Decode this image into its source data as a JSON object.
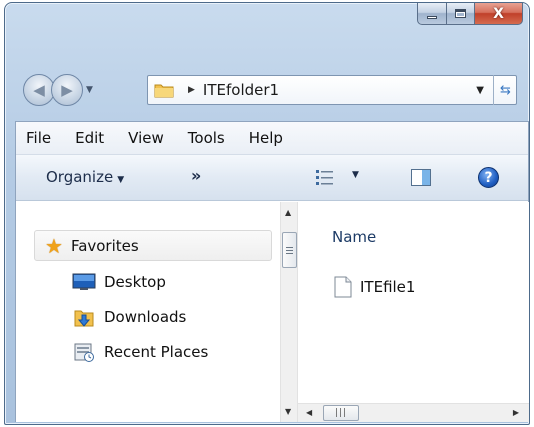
{
  "window": {
    "caption_buttons": {
      "minimize_icon": "minimize-icon",
      "maximize_icon": "maximize-icon",
      "close_icon": "close-icon",
      "close_glyph": "X"
    }
  },
  "navigation": {
    "back_icon": "back-arrow-icon",
    "forward_icon": "forward-arrow-icon",
    "history_icon": "chevron-down-icon"
  },
  "address_bar": {
    "folder_icon": "folder-icon",
    "path": "ITEfolder1",
    "refresh_icon": "refresh-icon"
  },
  "menu": {
    "items": [
      "File",
      "Edit",
      "View",
      "Tools",
      "Help"
    ]
  },
  "toolbar": {
    "organize_label": "Organize",
    "more_label": "»",
    "views_icon": "views-icon",
    "preview_pane_icon": "preview-pane-icon",
    "help_icon": "help-icon",
    "help_glyph": "?"
  },
  "nav_pane": {
    "favorites_label": "Favorites",
    "items": [
      {
        "label": "Desktop",
        "icon": "desktop-icon"
      },
      {
        "label": "Downloads",
        "icon": "downloads-icon"
      },
      {
        "label": "Recent Places",
        "icon": "recent-places-icon"
      }
    ]
  },
  "content": {
    "column_header": "Name",
    "files": [
      {
        "name": "ITEfile1",
        "icon": "file-icon"
      }
    ]
  },
  "colors": {
    "frame": "#b4cbe4",
    "close_button": "#c0402a",
    "accent_blue": "#1f5ec2",
    "favorites_star": "#f0a21a"
  }
}
